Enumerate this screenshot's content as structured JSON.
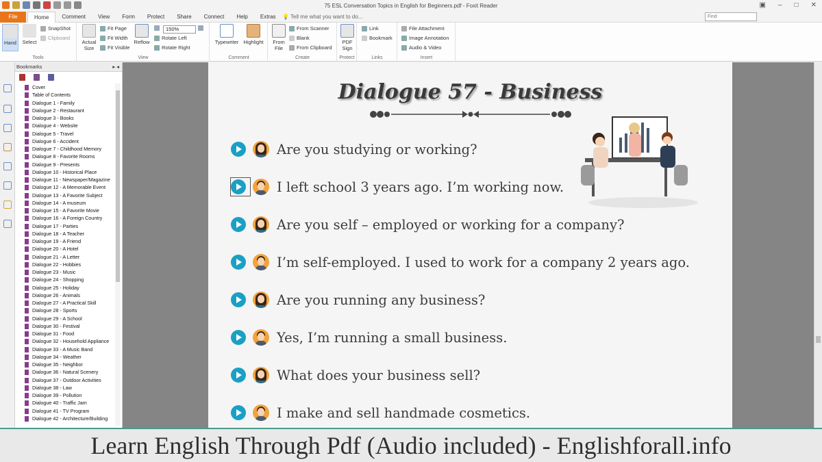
{
  "window": {
    "title": "75 ESL Conversation Topics in English for Beginners.pdf - Foxit Reader"
  },
  "menu": {
    "file": "File",
    "tabs": [
      "Home",
      "Comment",
      "View",
      "Form",
      "Protect",
      "Share",
      "Connect",
      "Help",
      "Extras"
    ],
    "tell_me": "Tell me what you want to do...",
    "find_placeholder": "Find"
  },
  "ribbon": {
    "tools": {
      "hand": "Hand",
      "select": "Select",
      "snapshot": "SnapShot",
      "clipboard": "Clipboard",
      "label": "Tools"
    },
    "view": {
      "actual_size": "Actual Size",
      "fit_page": "Fit Page",
      "fit_width": "Fit Width",
      "fit_visible": "Fit Visible",
      "reflow": "Reflow",
      "zoom": "150%",
      "rotate_left": "Rotate Left",
      "rotate_right": "Rotate Right",
      "label": "View"
    },
    "comment": {
      "typewriter": "Typewriter",
      "highlight": "Highlight",
      "label": "Comment"
    },
    "create": {
      "from_file": "From File",
      "from_scanner": "From Scanner",
      "blank": "Blank",
      "from_clipboard": "From Clipboard",
      "label": "Create"
    },
    "protect": {
      "pdf_sign": "PDF Sign",
      "label": "Protect"
    },
    "links": {
      "link": "Link",
      "bookmark": "Bookmark",
      "label": "Links"
    },
    "insert": {
      "file_attachment": "File Attachment",
      "image_annotation": "Image Annotation",
      "audio_video": "Audio & Video",
      "label": "Insert"
    }
  },
  "bookmarks": {
    "header": "Bookmarks",
    "items": [
      "Cover",
      "Table of Contents",
      "Dialogue 1 - Family",
      "Dialogue 2 - Restaurant",
      "Dialogue 3 - Books",
      "Dialogue 4 - Website",
      "Dialogue 5 - Travel",
      "Dialogue 6 - Accident",
      "Dialogue 7 - Childhood Memory",
      "Dialogue 8 - Favorite Rooms",
      "Dialogue 9 - Presents",
      "Dialogue 10 - Historical Place",
      "Dialogue 11 - Newspaper/Magazine",
      "Dialogue 12 - A Memorable Event",
      "Dialogue 13 - A Favorite Subject",
      "Dialogue 14 - A museum",
      "Dialogue 15 - A Favorite Movie",
      "Dialogue 16 - A Foreign Country",
      "Dialogue 17 - Parties",
      "Dialogue 18 - A Teacher",
      "Dialogue 19 - A Friend",
      "Dialogue 20 - A Hotel",
      "Dialogue 21 - A Letter",
      "Dialogue 22 - Hobbies",
      "Dialogue 23 - Music",
      "Dialogue 24 - Shopping",
      "Dialogue 25 - Holiday",
      "Dialogue 26 - Animals",
      "Dialogue 27 - A Practical Skill",
      "Dialogue 28 - Sports",
      "Dialogue 29 - A School",
      "Dialogue 30 - Festival",
      "Dialogue 31 - Food",
      "Dialogue 32 - Household Appliance",
      "Dialogue 33 - A Music Band",
      "Dialogue 34 - Weather",
      "Dialogue 35 - Neighbor",
      "Dialogue 36 - Natural Scenery",
      "Dialogue 37 - Outdoor Activities",
      "Dialogue 38 - Law",
      "Dialogue 39 - Pollution",
      "Dialogue 40 - Traffic Jam",
      "Dialogue 41 - TV Program",
      "Dialogue 42 - Architecture/Building"
    ]
  },
  "page": {
    "title": "Dialogue 57 - Business",
    "lines": [
      {
        "speaker": "female",
        "text": "Are you studying or working?"
      },
      {
        "speaker": "male",
        "text": "I left school 3 years ago. I’m working now."
      },
      {
        "speaker": "female",
        "text": "Are you self – employed or working for a company?"
      },
      {
        "speaker": "male",
        "text": "I’m self-employed. I used to work for a company 2 years ago."
      },
      {
        "speaker": "female",
        "text": "Are you running any business?"
      },
      {
        "speaker": "male",
        "text": "Yes, I’m running a small business."
      },
      {
        "speaker": "female",
        "text": "What does your business sell?"
      },
      {
        "speaker": "male",
        "text": "I make and sell handmade cosmetics."
      }
    ]
  },
  "caption": "Learn English Through Pdf (Audio included) - Englishforall.info",
  "colors": {
    "accent": "#e8751a",
    "play": "#1aa0c4",
    "bookmark_icon": "#8a3b8e"
  }
}
